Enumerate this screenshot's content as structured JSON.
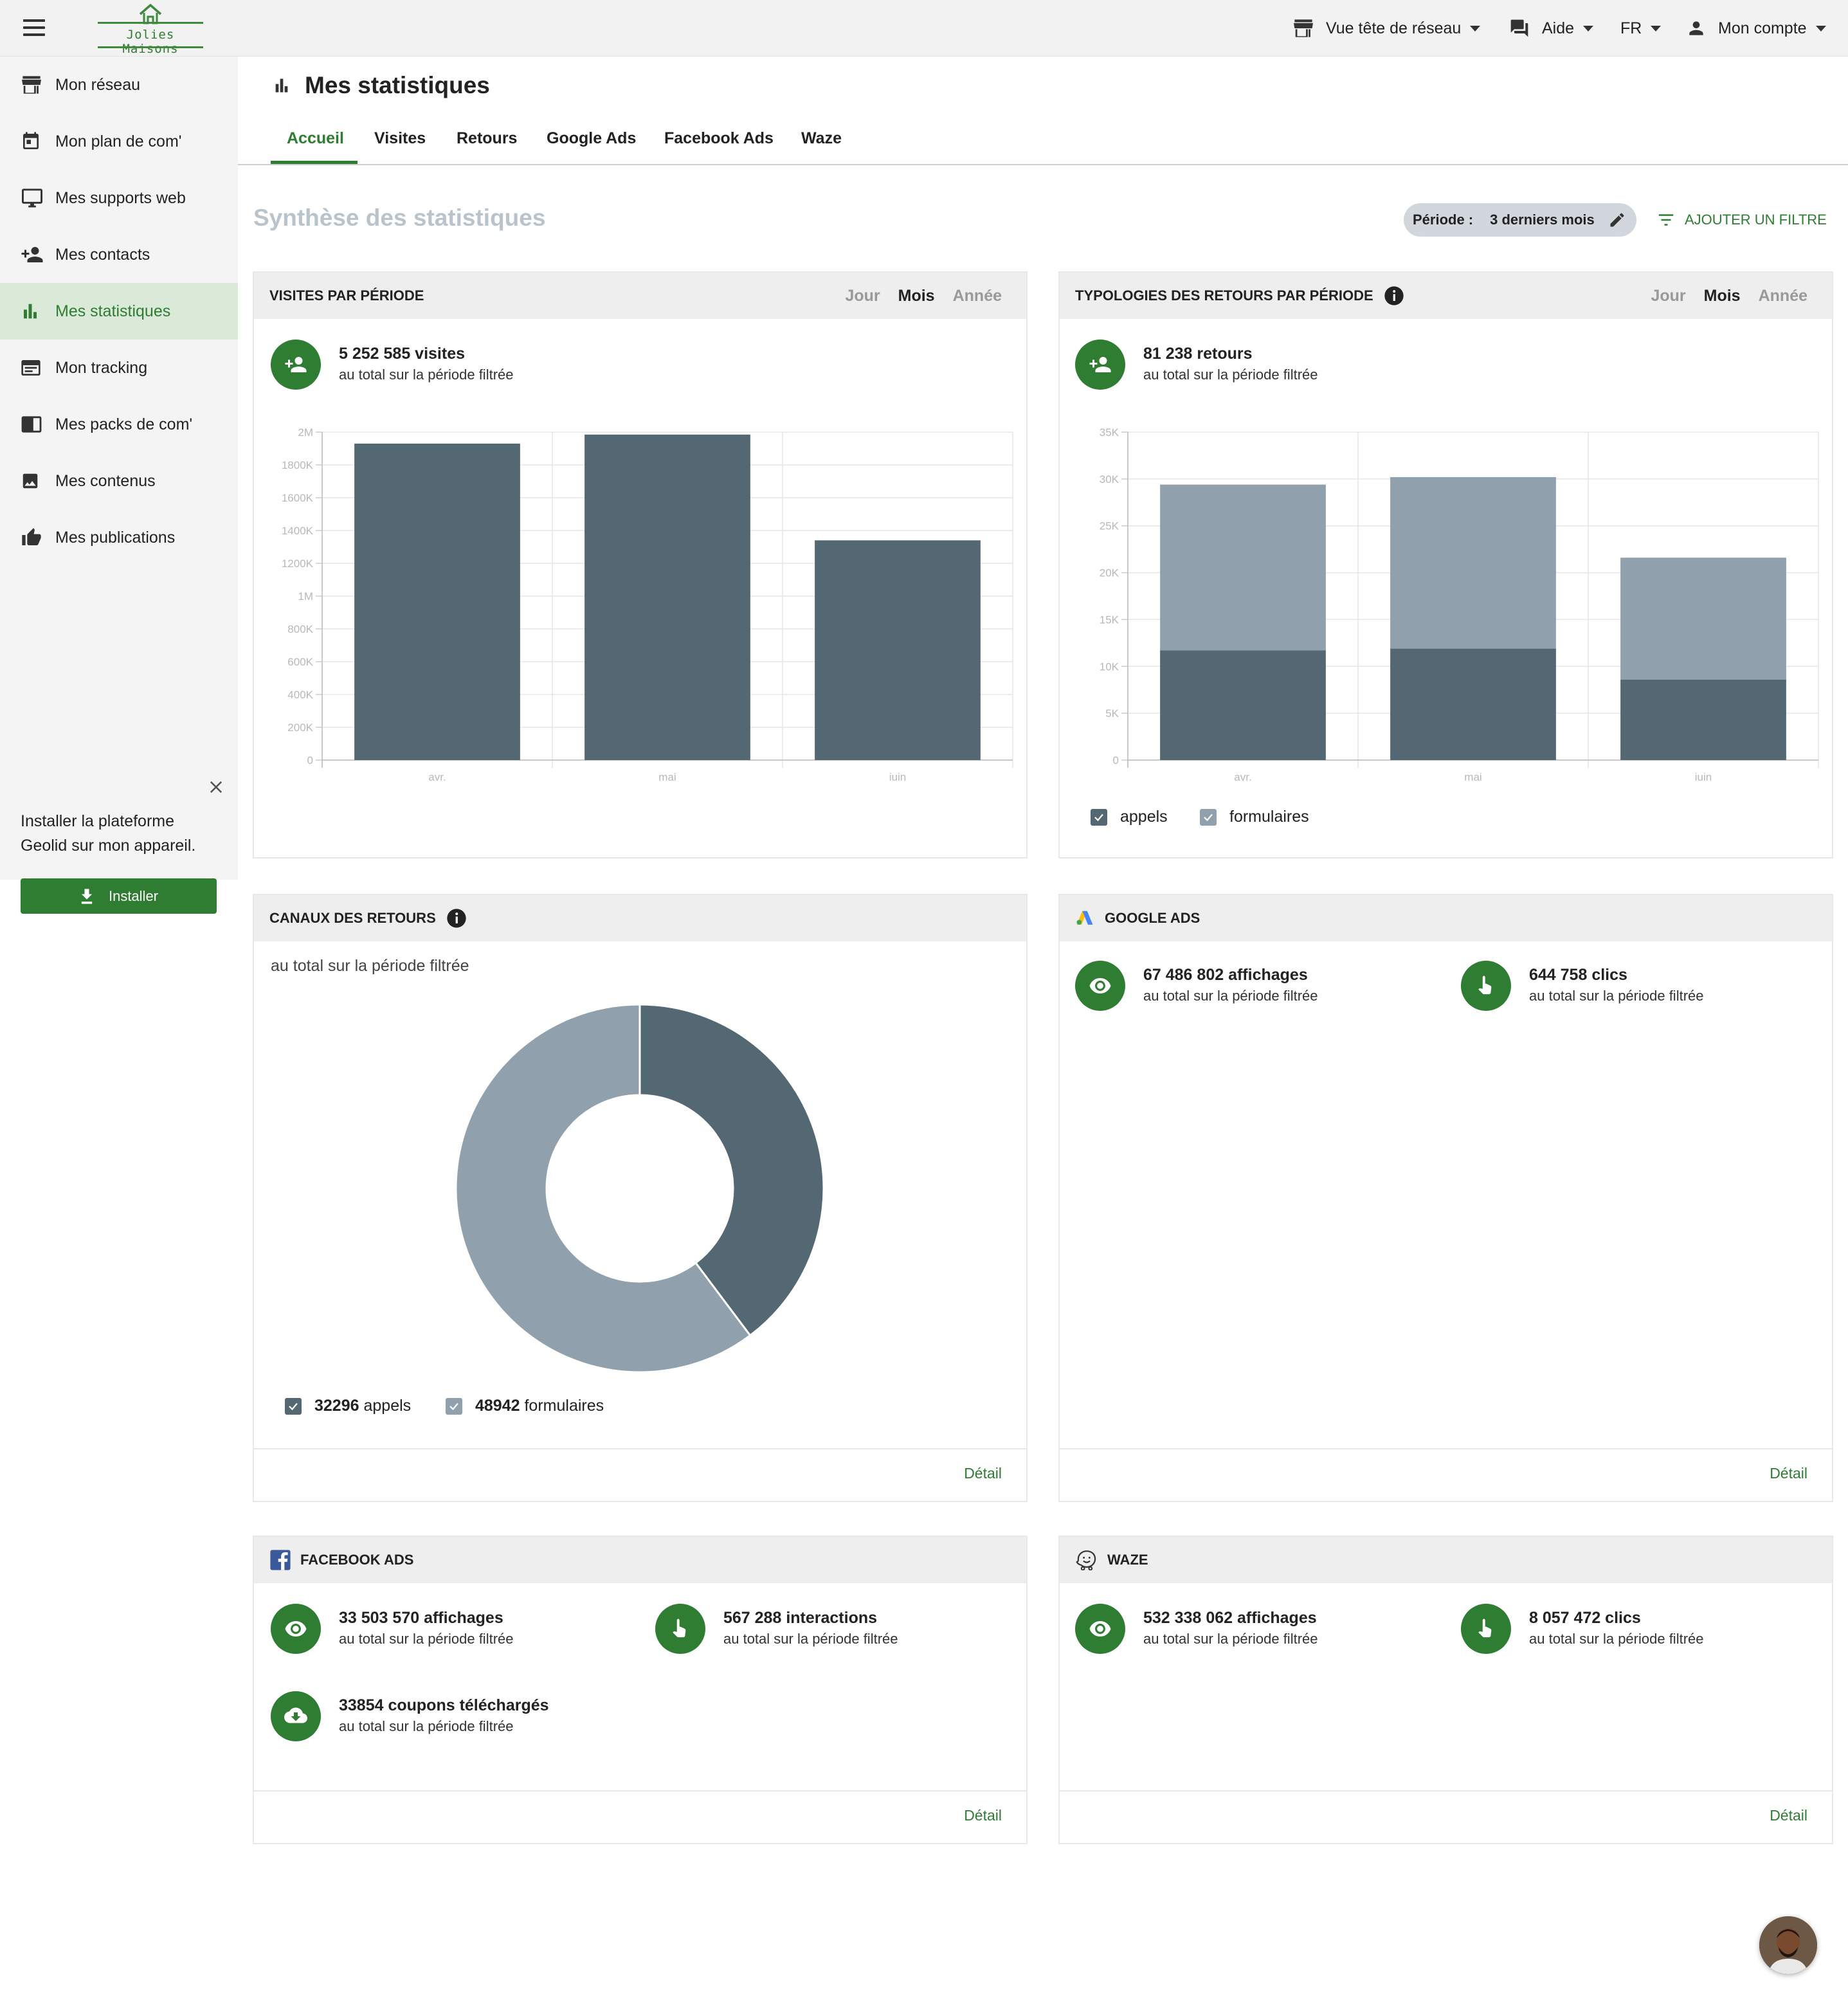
{
  "app": {
    "brand": "Jolies Maisons"
  },
  "topnav": {
    "reseau": "Vue tête de réseau",
    "aide": "Aide",
    "lang": "FR",
    "compte": "Mon compte"
  },
  "sidebar": {
    "items": [
      {
        "label": "Mon réseau",
        "icon": "store-icon"
      },
      {
        "label": "Mon plan de com'",
        "icon": "calendar-icon"
      },
      {
        "label": "Mes supports web",
        "icon": "monitor-icon"
      },
      {
        "label": "Mes contacts",
        "icon": "person-add-icon"
      },
      {
        "label": "Mes statistiques",
        "icon": "bar-chart-icon"
      },
      {
        "label": "Mon tracking",
        "icon": "tracking-icon"
      },
      {
        "label": "Mes packs de com'",
        "icon": "pack-icon"
      },
      {
        "label": "Mes contenus",
        "icon": "image-icon"
      },
      {
        "label": "Mes publications",
        "icon": "thumb-up-icon"
      }
    ],
    "active_index": 4,
    "install": {
      "line1": "Installer la plateforme",
      "line2": "Geolid sur mon appareil.",
      "button": "Installer"
    }
  },
  "page": {
    "title": "Mes statistiques",
    "section_title": "Synthèse des statistiques"
  },
  "tabs": [
    "Accueil",
    "Visites",
    "Retours",
    "Google Ads",
    "Facebook Ads",
    "Waze"
  ],
  "active_tab": 0,
  "filters": {
    "periode_label": "Période :",
    "periode_value": "3 derniers mois",
    "add_filter": "AJOUTER UN FILTRE"
  },
  "period_options": [
    "Jour",
    "Mois",
    "Année"
  ],
  "selected_period": "Mois",
  "common": {
    "subtitle": "au total sur la période filtrée",
    "detail": "Détail"
  },
  "colors": {
    "primary": "#2e7d32",
    "dark_bar": "#546873",
    "light_bar": "#90a1ad"
  },
  "visites": {
    "title": "VISITES PAR PÉRIODE",
    "total": "5 252 585 visites",
    "chart_data": {
      "type": "bar",
      "categories": [
        "avr.",
        "mai",
        "juin"
      ],
      "values": [
        1930000,
        1985000,
        1340000
      ],
      "ylim": [
        0,
        2000000
      ],
      "yticks": [
        "0",
        "200K",
        "400K",
        "600K",
        "800K",
        "1M",
        "1200K",
        "1400K",
        "1600K",
        "1800K",
        "2M"
      ],
      "grid": true
    }
  },
  "retours": {
    "title": "TYPOLOGIES DES RETOURS PAR PÉRIODE",
    "total": "81 238 retours",
    "chart_data": {
      "type": "bar",
      "stacked": true,
      "categories": [
        "avr.",
        "mai",
        "juin"
      ],
      "series": [
        {
          "name": "appels",
          "values": [
            11700,
            11900,
            8600
          ]
        },
        {
          "name": "formulaires",
          "values": [
            17700,
            18300,
            13000
          ]
        }
      ],
      "ylim": [
        0,
        35000
      ],
      "yticks": [
        "0",
        "5K",
        "10K",
        "15K",
        "20K",
        "25K",
        "30K",
        "35K"
      ],
      "grid": true,
      "legend": "bottom-left"
    }
  },
  "canaux": {
    "title": "CANAUX DES RETOURS",
    "chart_data": {
      "type": "pie",
      "donut": true,
      "slices": [
        {
          "name": "appels",
          "value": 32296
        },
        {
          "name": "formulaires",
          "value": 48942
        }
      ],
      "legend": "bottom-left"
    },
    "legend": [
      {
        "count": "32296",
        "label": "appels"
      },
      {
        "count": "48942",
        "label": "formulaires"
      }
    ]
  },
  "google_ads": {
    "title": "GOOGLE ADS",
    "affichages": "67 486 802 affichages",
    "clics": "644 758 clics"
  },
  "facebook_ads": {
    "title": "FACEBOOK ADS",
    "affichages": "33 503 570 affichages",
    "interactions": "567 288 interactions",
    "coupons": "33854 coupons téléchargés"
  },
  "waze": {
    "title": "WAZE",
    "affichages": "532 338 062 affichages",
    "clics": "8 057 472 clics"
  }
}
